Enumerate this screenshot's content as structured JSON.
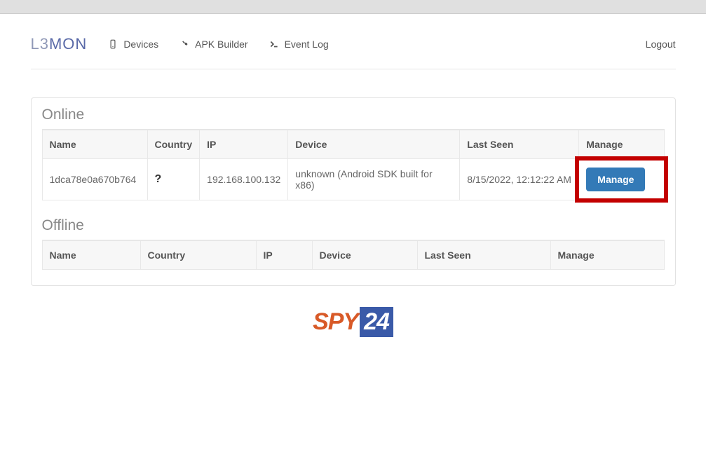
{
  "logo": {
    "part1": "L3",
    "part2": "MON"
  },
  "nav": {
    "devices": "Devices",
    "apk_builder": "APK Builder",
    "event_log": "Event Log",
    "logout": "Logout"
  },
  "sections": {
    "online": {
      "title": "Online",
      "headers": {
        "name": "Name",
        "country": "Country",
        "ip": "IP",
        "device": "Device",
        "last_seen": "Last Seen",
        "manage": "Manage"
      },
      "rows": [
        {
          "name": "1dca78e0a670b764",
          "country": "?",
          "ip": "192.168.100.132",
          "device": "unknown (Android SDK built for x86)",
          "last_seen": "8/15/2022, 12:12:22 AM",
          "manage_label": "Manage"
        }
      ]
    },
    "offline": {
      "title": "Offline",
      "headers": {
        "name": "Name",
        "country": "Country",
        "ip": "IP",
        "device": "Device",
        "last_seen": "Last Seen",
        "manage": "Manage"
      }
    }
  },
  "watermark": {
    "text1": "SPY",
    "text2": "24"
  }
}
